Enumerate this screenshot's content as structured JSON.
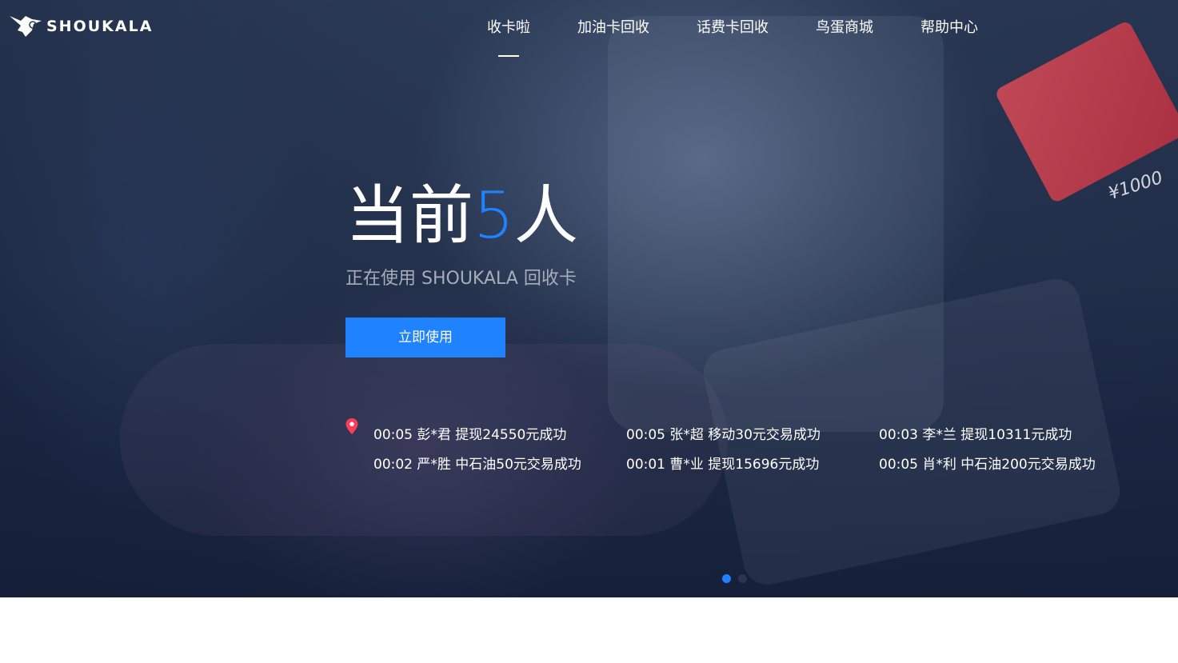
{
  "brand": {
    "name": "SHOUKALA",
    "logo_icon": "hummingbird-icon"
  },
  "nav": {
    "items": [
      {
        "label": "收卡啦",
        "active": true
      },
      {
        "label": "加油卡回收",
        "active": false
      },
      {
        "label": "话费卡回收",
        "active": false
      },
      {
        "label": "鸟蛋商城",
        "active": false
      },
      {
        "label": "帮助中心",
        "active": false
      }
    ]
  },
  "hero": {
    "headline_prefix": "当前",
    "headline_count": "5",
    "headline_suffix": "人",
    "subline": "正在使用 SHOUKALA 回收卡",
    "cta_label": "立即使用",
    "card_text": "¥1000"
  },
  "ticker": {
    "icon": "location-pin-icon",
    "rows": [
      [
        "00:05 彭*君 提现24550元成功",
        "00:05 张*超 移动30元交易成功",
        "00:03 李*兰 提现10311元成功"
      ],
      [
        "00:02 严*胜 中石油50元交易成功",
        "00:01 曹*业 提现15696元成功",
        "00:05 肖*利 中石油200元交易成功"
      ]
    ]
  },
  "carousel": {
    "slide_count": 2,
    "active_index": 0
  },
  "colors": {
    "accent": "#1f82ff",
    "pin": "#ff3b5c",
    "subline": "#a7adb8"
  }
}
